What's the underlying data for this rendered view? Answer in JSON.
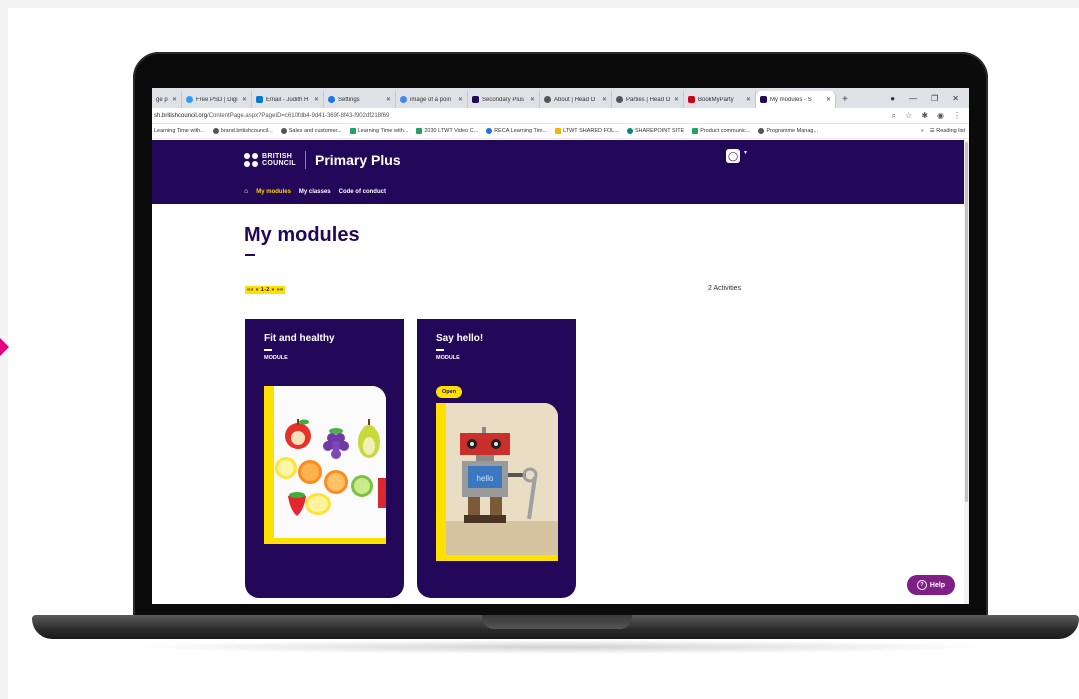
{
  "browser": {
    "tabs": [
      {
        "label": "ge p",
        "color": "#1a73e8"
      },
      {
        "label": "Free PSD | Digi",
        "color": "#2a9df4"
      },
      {
        "label": "Email - Judith H",
        "color": "#0078d4"
      },
      {
        "label": "Settings",
        "color": "#1a73e8"
      },
      {
        "label": "image of a poin",
        "color": "#4285f4"
      },
      {
        "label": "Secondary Plus",
        "color": "#23085a"
      },
      {
        "label": "About | Head O",
        "color": "#555555"
      },
      {
        "label": "Parties | Head O",
        "color": "#555555"
      },
      {
        "label": "BookMyParty",
        "color": "#d0021b"
      },
      {
        "label": "My modules - S",
        "color": "#23085a",
        "active": true
      }
    ],
    "new_tab": "+",
    "url_prefix": "sh.britishcouncil.org",
    "url_rest": "/ContentPage.aspx?PageID=c610fdb4-9d41-369f-8f43-f902df218f69",
    "bookmarks": [
      {
        "label": "Learning Time with...",
        "color": "#ffffff"
      },
      {
        "label": "brand.britishcouncil...",
        "color": "#555555"
      },
      {
        "label": "Sales and customer...",
        "color": "#555555"
      },
      {
        "label": "Learning Time with...",
        "color": "#21a366"
      },
      {
        "label": "2030 LTWT Video C...",
        "color": "#21a366"
      },
      {
        "label": "RECA Learning Tim...",
        "color": "#1a73e8"
      },
      {
        "label": "LTWT SHARED FOL...",
        "color": "#f4b400"
      },
      {
        "label": "SHAREPOINT SITE",
        "color": "#038387"
      },
      {
        "label": "Product communic...",
        "color": "#21a366"
      },
      {
        "label": "Programme Manag...",
        "color": "#555555"
      }
    ],
    "bookmarks_more": "»",
    "reading_list": "Reading list"
  },
  "site": {
    "logo_line1": "BRITISH",
    "logo_line2": "COUNCIL",
    "product": "Primary Plus",
    "nav": [
      {
        "label": "My modules",
        "active": true
      },
      {
        "label": "My classes",
        "active": false
      },
      {
        "label": "Code of conduct",
        "active": false
      }
    ]
  },
  "main": {
    "title": "My modules",
    "pager": "«« « 1-2 » »»",
    "activities": "2 Activities",
    "cards": [
      {
        "title": "Fit and healthy",
        "subtitle": "MODULE",
        "image": "fruit-image"
      },
      {
        "title": "Say hello!",
        "subtitle": "MODULE",
        "badge": "Open",
        "image": "robot-image"
      }
    ]
  },
  "help": {
    "label": "Help"
  },
  "colors": {
    "brand_purple": "#23085a",
    "accent_yellow": "#ffe000",
    "help_purple": "#7f1f86",
    "nav_active": "#ffd400"
  }
}
